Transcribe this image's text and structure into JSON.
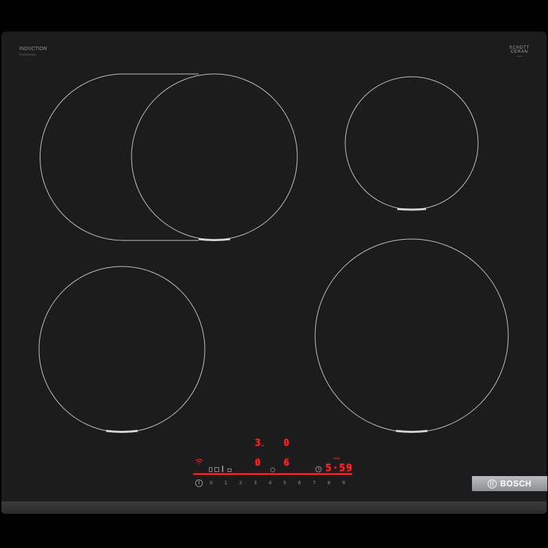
{
  "cooktop": {
    "label": "INDUCTION",
    "label_sub": "PXE631NC1",
    "glass_brand_line1": "SCHOTT",
    "glass_brand_line2": "CERAN",
    "glass_brand_sub": "ceran",
    "brand": "BOSCH"
  },
  "displays": {
    "zone_rear_left_level": "3",
    "zone_rear_left_sub": "b",
    "zone_rear_right_level": "0",
    "zone_front_left_level": "0",
    "zone_front_right_level": "6",
    "timer_value": "5·59",
    "timer_label": "min"
  },
  "power_scale": [
    "0",
    "1",
    "2",
    "3",
    "4",
    "5",
    "6",
    "7",
    "8",
    "9"
  ],
  "colors": {
    "glass": "#1c1c1e",
    "display_red": "#ff2a2a",
    "zone_outline": "#c8c8c8",
    "brand_badge": "#a3a6ab"
  },
  "icons": [
    "wifi-icon",
    "power-icon",
    "timer-icon",
    "bosch-logo-icon"
  ]
}
